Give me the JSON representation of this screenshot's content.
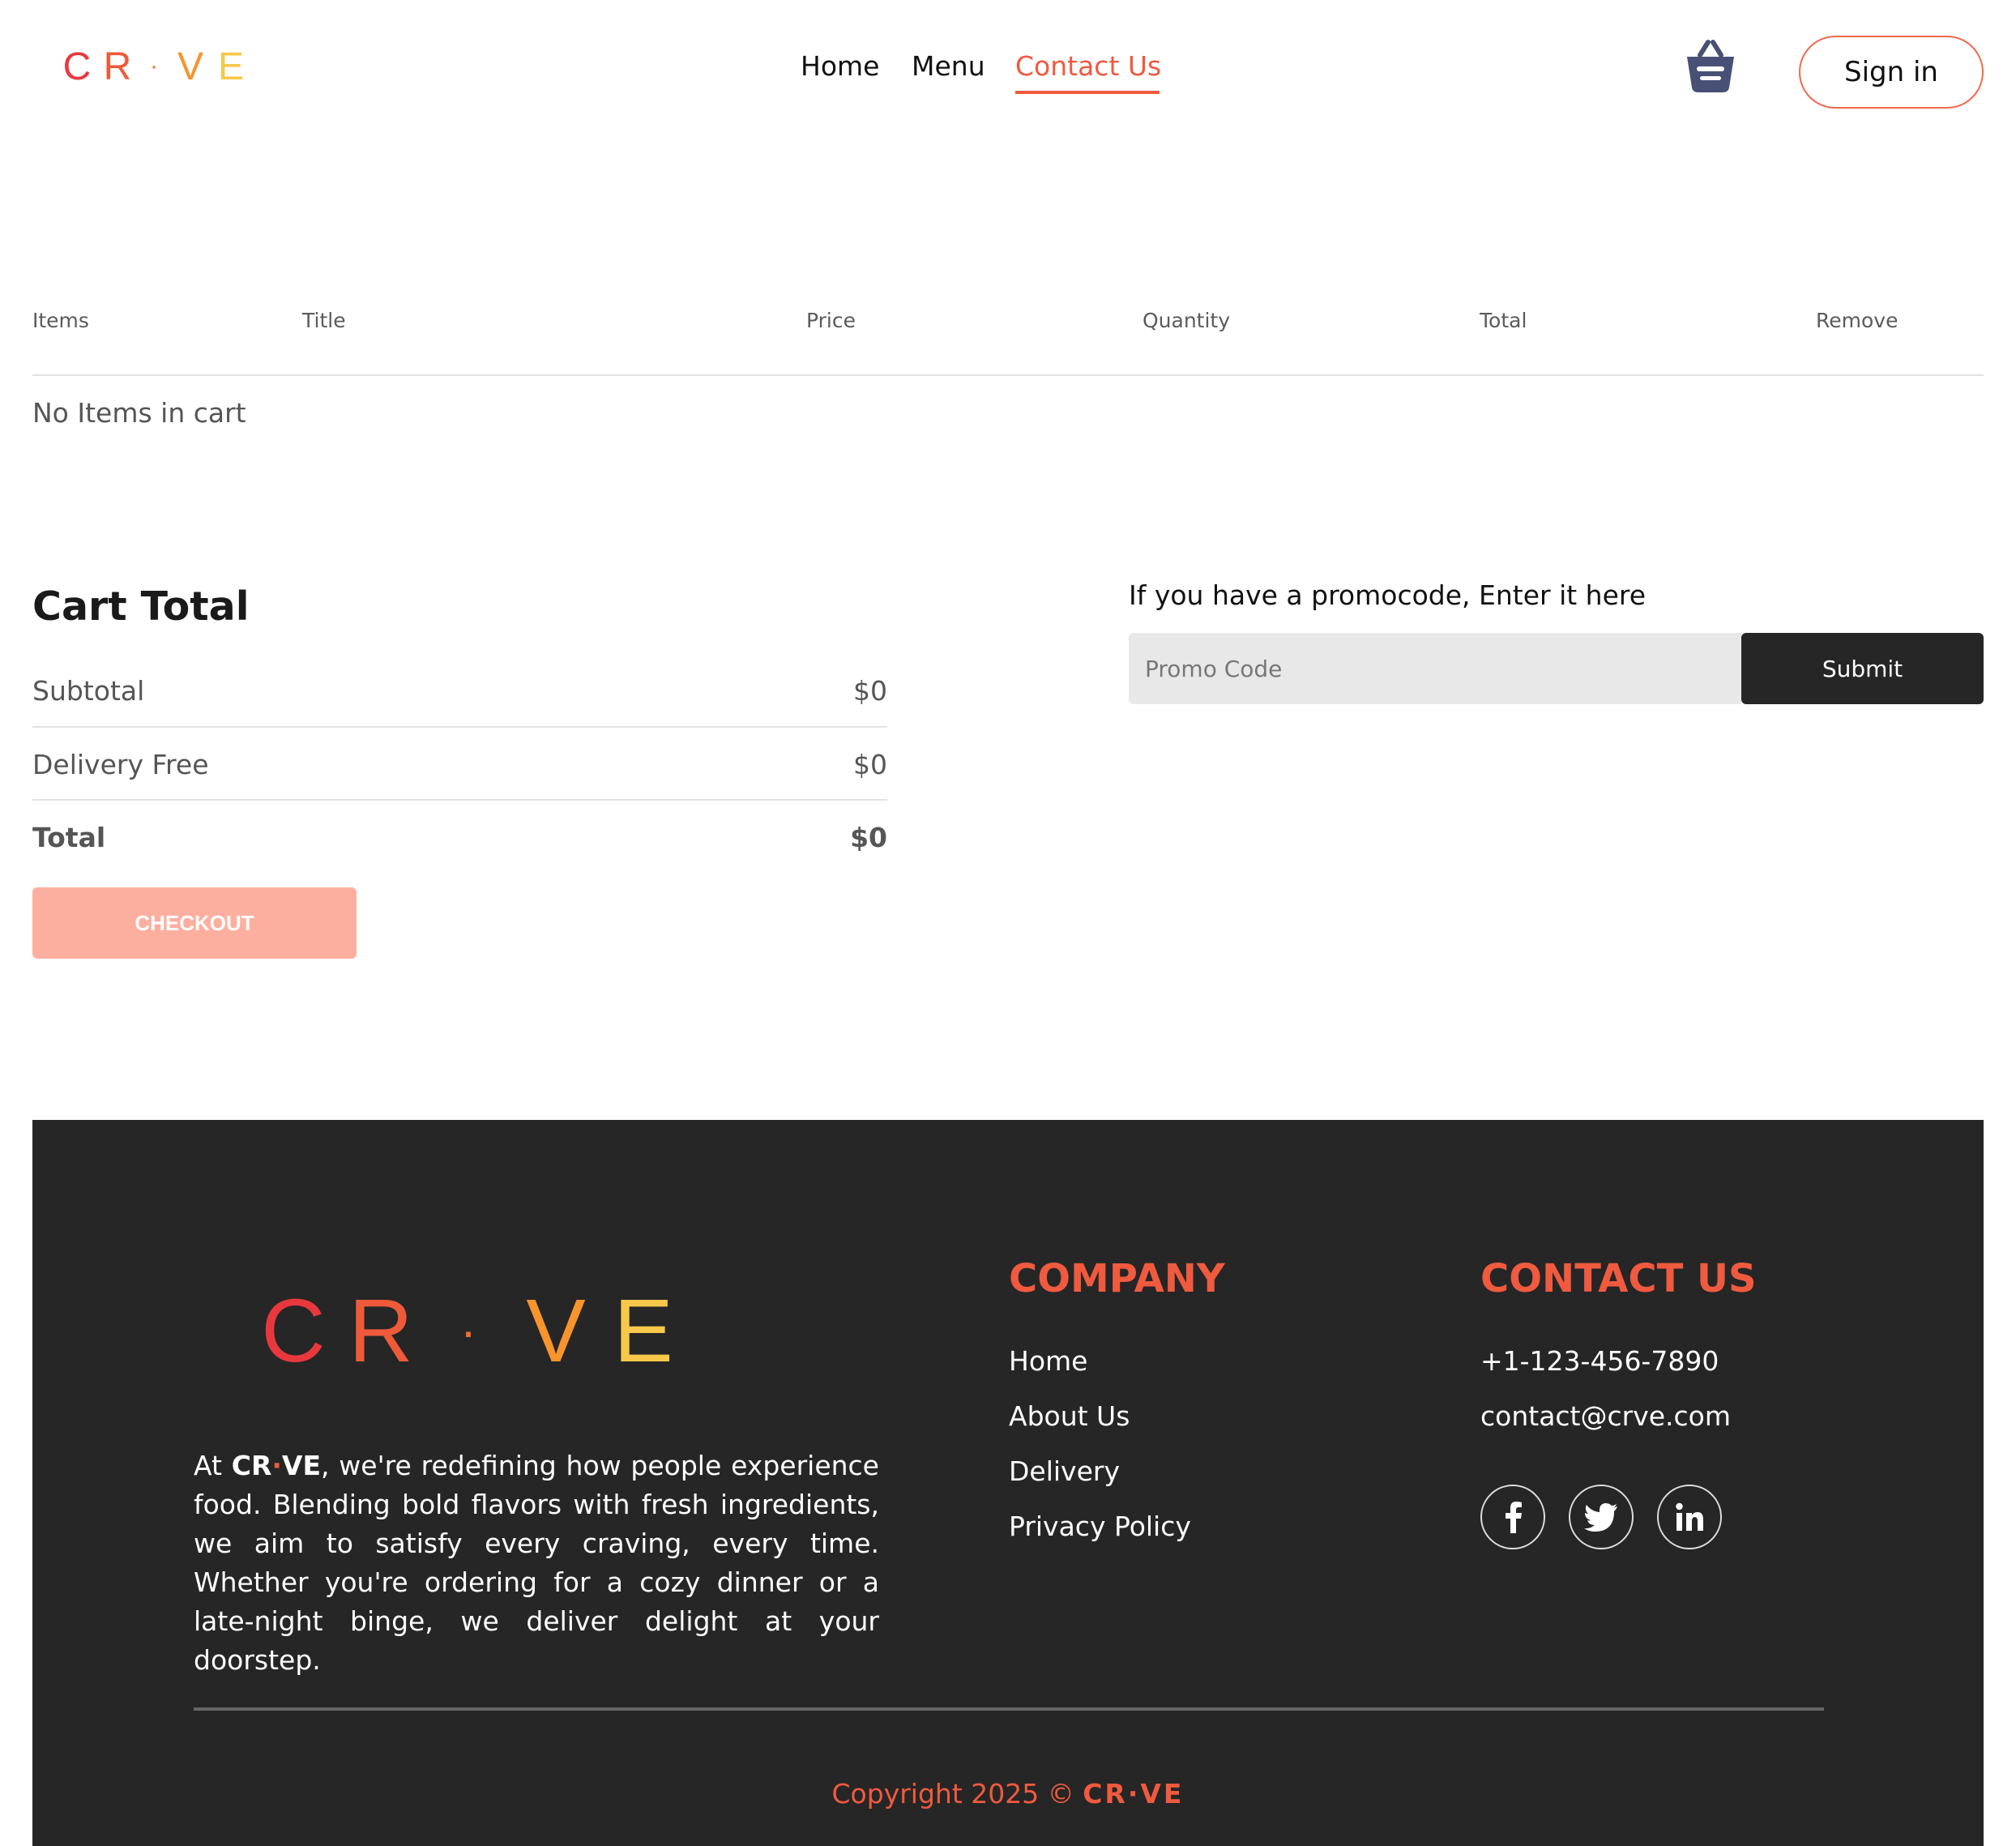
{
  "brand": {
    "letters": [
      "C",
      "R",
      "·",
      "V",
      "E"
    ],
    "letter_colors": [
      "#e8383e",
      "#ef5a3a",
      "#f36d2e",
      "#f7942d",
      "#f7c84a"
    ]
  },
  "nav": {
    "items": [
      "Home",
      "Menu",
      "Contact Us"
    ],
    "active": "Contact Us",
    "signin_label": "Sign in",
    "basket_icon": "basket-icon"
  },
  "cart_table": {
    "headers": [
      "Items",
      "Title",
      "Price",
      "Quantity",
      "Total",
      "Remove"
    ],
    "empty_message": "No Items in cart"
  },
  "cart_total": {
    "title": "Cart Total",
    "rows": [
      {
        "label": "Subtotal",
        "value": "$0"
      },
      {
        "label": "Delivery Free",
        "value": "$0"
      },
      {
        "label": "Total",
        "value": "$0"
      }
    ],
    "checkout_label": "CHECKOUT"
  },
  "promo": {
    "label": "If you have a promocode, Enter it here",
    "placeholder": "Promo Code",
    "submit_label": "Submit"
  },
  "footer": {
    "about_prefix": "At ",
    "about_brand_a": "CR",
    "about_brand_dot": "·",
    "about_brand_b": "VE",
    "about_text": ", we're redefining how people experience food. Blending bold flavors with fresh ingredients, we aim to satisfy every craving, every time. Whether you're ordering for a cozy dinner or a late-night binge, we deliver delight at your doorstep.",
    "company_heading": "COMPANY",
    "company_links": [
      "Home",
      "About Us",
      "Delivery",
      "Privacy Policy"
    ],
    "contact_heading": "CONTACT US",
    "phone": "+1-123-456-7890",
    "email": "contact@crve.com",
    "social": [
      "facebook-icon",
      "twitter-icon",
      "linkedin-icon"
    ],
    "copyright_text": "Copyright 2025 © ",
    "copyright_brand": "CR·VE"
  },
  "colors": {
    "accent": "#f05a3f",
    "dark": "#262626",
    "checkout_bg": "#fdaf9f"
  }
}
